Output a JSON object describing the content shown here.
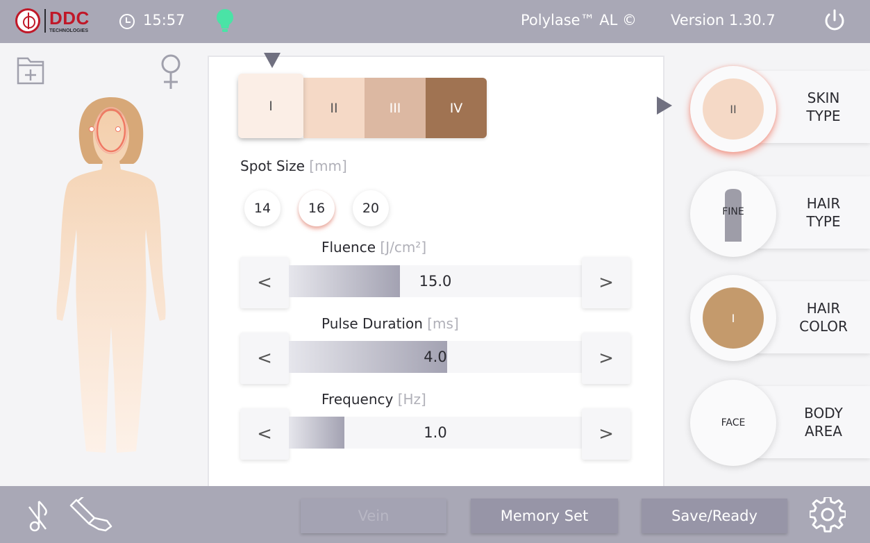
{
  "header": {
    "logo_text": "DDC",
    "logo_subtext": "TECHNOLOGIES",
    "time": "15:57",
    "product": "Polylase™ AL ©",
    "version": "Version 1.30.7",
    "status_light_color": "#4ae3a6"
  },
  "skin_scale": {
    "segments": [
      "I",
      "II",
      "III",
      "IV"
    ],
    "colors": [
      "#fbeee6",
      "#f5d9c6",
      "#dcb8a2",
      "#a07352"
    ],
    "selected": "I"
  },
  "spot_size": {
    "label": "Spot Size",
    "unit": "[mm]",
    "options": [
      "14",
      "16",
      "20"
    ],
    "selected": "16"
  },
  "params": {
    "fluence": {
      "label": "Fluence",
      "unit": "[J/cm²]",
      "value": "15.0",
      "fill_fraction": 0.38
    },
    "pulse_duration": {
      "label": "Pulse Duration",
      "unit": "[ms]",
      "value": "4.0",
      "fill_fraction": 0.54
    },
    "frequency": {
      "label": "Frequency",
      "unit": "[Hz]",
      "value": "1.0",
      "fill_fraction": 0.19
    },
    "arrow_left": "<",
    "arrow_right": ">"
  },
  "right_panel": {
    "skin_type": {
      "label_line1": "SKIN",
      "label_line2": "TYPE",
      "value": "II"
    },
    "hair_type": {
      "label_line1": "HAIR",
      "label_line2": "TYPE",
      "value": "FINE"
    },
    "hair_color": {
      "label_line1": "HAIR",
      "label_line2": "COLOR",
      "value": "I"
    },
    "body_area": {
      "label_line1": "BODY",
      "label_line2": "AREA",
      "value": "FACE"
    }
  },
  "footer": {
    "vein": "Vein",
    "memory_set": "Memory Set",
    "save_ready": "Save/Ready"
  },
  "colors": {
    "bar_background": "#a9a8b6",
    "accent_red": "#c01828",
    "active_glow": "#f07864"
  }
}
